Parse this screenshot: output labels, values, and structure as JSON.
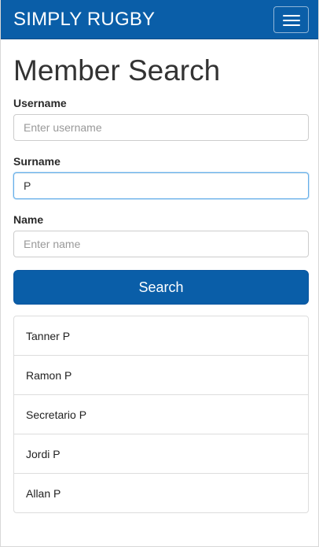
{
  "navbar": {
    "brand": "SIMPLY RUGBY",
    "toggle_icon": "hamburger-menu-icon",
    "background_color": "#0a5ea8"
  },
  "page": {
    "title": "Member Search"
  },
  "form": {
    "username": {
      "label": "Username",
      "placeholder": "Enter username",
      "value": ""
    },
    "surname": {
      "label": "Surname",
      "placeholder": "",
      "value": "P"
    },
    "name": {
      "label": "Name",
      "placeholder": "Enter name",
      "value": ""
    },
    "search_label": "Search"
  },
  "results": [
    {
      "label": "Tanner P"
    },
    {
      "label": "Ramon P"
    },
    {
      "label": "Secretario P"
    },
    {
      "label": "Jordi P"
    },
    {
      "label": "Allan P"
    }
  ]
}
